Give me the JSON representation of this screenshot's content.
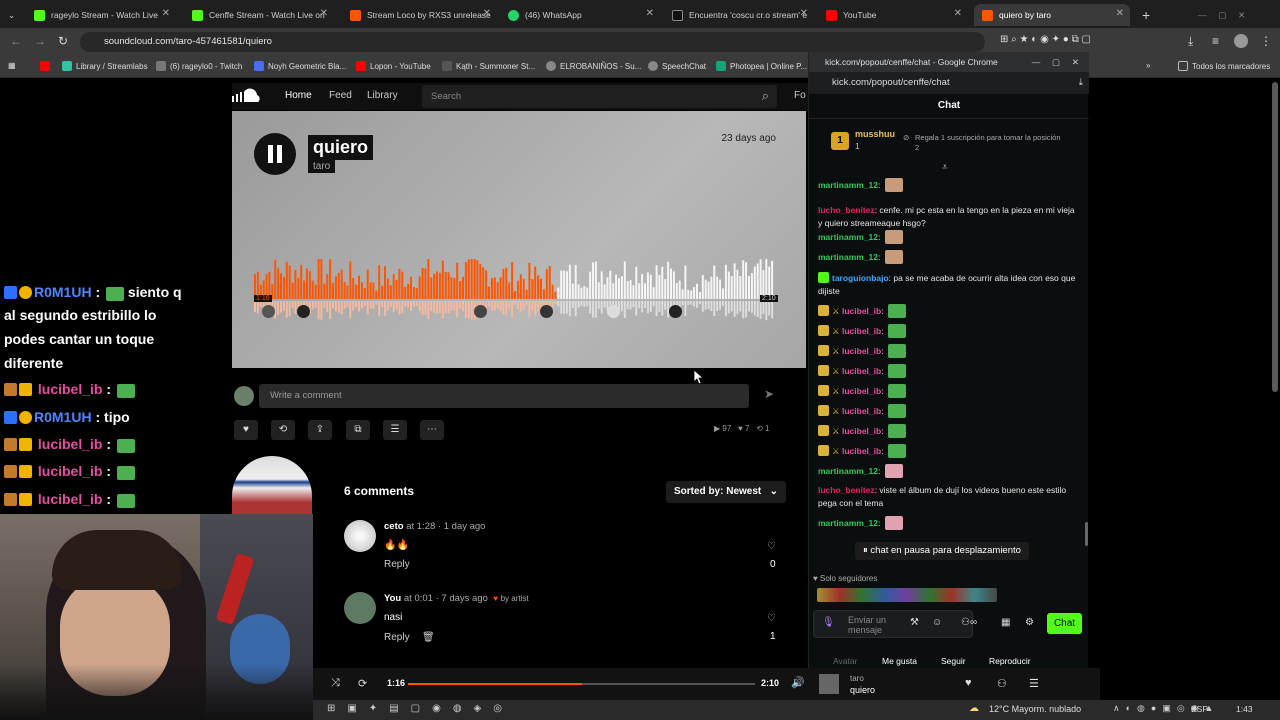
{
  "tabs": [
    {
      "label": "rageylo Stream - Watch Live",
      "color": "#53fc18"
    },
    {
      "label": "Cenffe Stream - Watch Live on",
      "color": "#53fc18"
    },
    {
      "label": "Stream Loco by RXS3 unrelease",
      "color": "#ff5500"
    },
    {
      "label": "(46) WhatsApp",
      "color": "#25d366"
    },
    {
      "label": "Encuentra 'coscu cr.o stream' e",
      "color": "#111111"
    },
    {
      "label": "YouTube",
      "color": "#ff0000"
    },
    {
      "label": "quiero by taro",
      "color": "#ff5500"
    }
  ],
  "url": "soundcloud.com/taro-457461581/quiero",
  "bookmarks": [
    "Library / Streamlabs",
    "(6) rageylo0 - Twitch",
    "Noyh Geometric Bla...",
    "Lopon - YouTube",
    "Kąth - Summoner St...",
    "ELROBANIÑOS - Su...",
    "SpeechChat",
    "Photopea | Online P...",
    "Todos los marcadores"
  ],
  "overlay_chat": [
    {
      "user": "R0M1UH",
      "text": "siento q",
      "cont": [
        "al segundo estribillo lo",
        "podes cantar un toque",
        "diferente"
      ],
      "color": "#2f6fff"
    },
    {
      "user": "lucibel_ib",
      "text": "",
      "color": "#e84ea0"
    },
    {
      "user": "R0M1UH",
      "text": "tipo",
      "color": "#2f6fff"
    },
    {
      "user": "lucibel_ib",
      "text": "",
      "color": "#e84ea0"
    },
    {
      "user": "lucibel_ib",
      "text": "",
      "color": "#e84ea0"
    },
    {
      "user": "lucibel_ib",
      "text": "",
      "color": "#e84ea0"
    }
  ],
  "soundcloud": {
    "nav": [
      "Home",
      "Feed",
      "Library"
    ],
    "search_placeholder": "Search",
    "more_label": "Fo",
    "track_title": "quiero",
    "artist": "taro",
    "posted": "23 days ago",
    "time_current": "1:16",
    "time_total": "2:10",
    "progress": 0.58,
    "comment_placeholder": "Write a comment",
    "plays": "97",
    "likes": "7",
    "reposts": "1",
    "comments_count": "6 comments",
    "sort_label": "Sorted by: Newest",
    "comments": [
      {
        "user": "ceto",
        "at": "at",
        "time": "1:28",
        "ago": "· 1 day ago",
        "text": "🔥🔥",
        "reply": "Reply",
        "likes": "0",
        "by_artist": ""
      },
      {
        "user": "You",
        "at": "at",
        "time": "0:01",
        "ago": "· 7 days ago",
        "text": "nasi",
        "reply": "Reply",
        "likes": "1",
        "by_artist": "by artist"
      }
    ]
  },
  "player": {
    "time_current": "1:16",
    "time_total": "2:10",
    "progress": 0.5,
    "artist": "taro",
    "title": "quiero"
  },
  "kick": {
    "window_title": "kick.com/popout/cenffe/chat - Google Chrome",
    "url": "kick.com/popout/cenffe/chat",
    "header": "Chat",
    "top_user": "musshuu",
    "top_count": "1",
    "gift_text": "Regala 1 suscripción para tomar la posición 2",
    "messages": [
      {
        "user": "martinamm_12",
        "text": "",
        "color": "#34c759"
      },
      {
        "user": "lucho_benitez",
        "text": "cenfe. mi pc esta en la tengo en la pieza en mi vieja y quiero streameaque hsgo?",
        "color": "#e0245e"
      },
      {
        "user": "martinamm_12",
        "text": "",
        "color": "#34c759"
      },
      {
        "user": "martinamm_12",
        "text": "",
        "color": "#34c759"
      },
      {
        "user": "taroguionbajo",
        "text": "pa se me acaba de ocurrir alta idea con eso que dijiste",
        "color": "#3fa7ff"
      },
      {
        "user": "lucibel_ib",
        "text": "",
        "color": "#e84ea0"
      },
      {
        "user": "lucibel_ib",
        "text": "",
        "color": "#e84ea0"
      },
      {
        "user": "lucibel_ib",
        "text": "",
        "color": "#e84ea0"
      },
      {
        "user": "lucibel_ib",
        "text": "",
        "color": "#e84ea0"
      },
      {
        "user": "lucibel_ib",
        "text": "",
        "color": "#e84ea0"
      },
      {
        "user": "lucibel_ib",
        "text": "",
        "color": "#e84ea0"
      },
      {
        "user": "lucibel_ib",
        "text": "",
        "color": "#e84ea0"
      },
      {
        "user": "lucibel_ib",
        "text": "",
        "color": "#e84ea0"
      },
      {
        "user": "martinamm_12",
        "text": "",
        "color": "#34c759"
      },
      {
        "user": "lucho_benitez",
        "text": "viste el álbum de dují los videos bueno este estilo pega con el tema",
        "color": "#e0245e"
      },
      {
        "user": "martinamm_12",
        "text": "",
        "color": "#34c759"
      }
    ],
    "paused_text": "chat en pausa para desplazamiento",
    "followers_only": "Solo seguidores",
    "input_placeholder": "Enviar un mensaje",
    "send_label": "Chat",
    "footer_tabs": [
      "Avatar",
      "Me gusta",
      "Seguir",
      "Reproducir"
    ]
  },
  "taskbar": {
    "weather": "12°C  Mayorm. nublado",
    "lang": "ESP",
    "time": "1:43"
  },
  "colors": {
    "accent": "#ff5500",
    "kick_green": "#53fc18"
  }
}
